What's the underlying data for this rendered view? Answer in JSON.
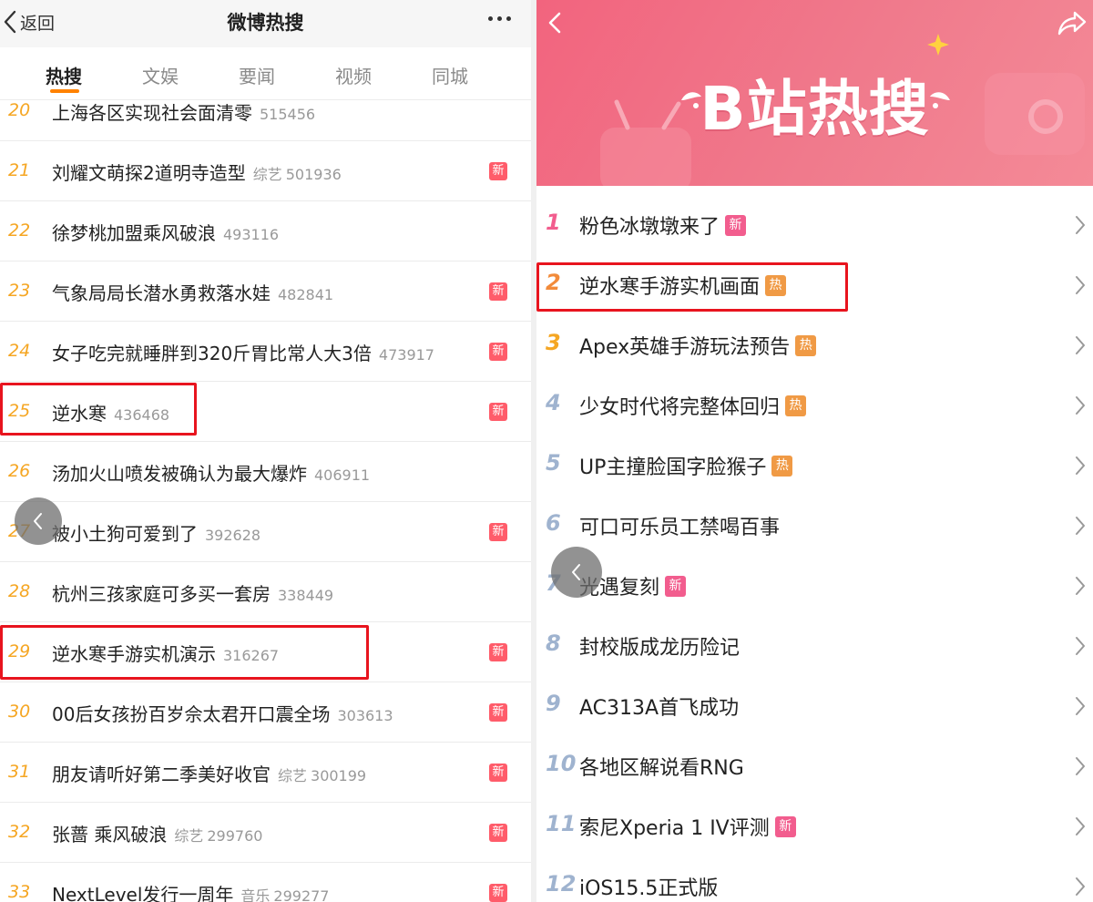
{
  "weibo": {
    "back_label": "返回",
    "title": "微博热搜",
    "tabs": [
      {
        "label": "热搜",
        "active": true
      },
      {
        "label": "文娱",
        "active": false
      },
      {
        "label": "要闻",
        "active": false
      },
      {
        "label": "视频",
        "active": false
      },
      {
        "label": "同城",
        "active": false
      }
    ],
    "items": [
      {
        "rank": "20",
        "title": "上海各区实现社会面清零",
        "category": "",
        "count": "515456",
        "badge": ""
      },
      {
        "rank": "21",
        "title": "刘耀文萌探2道明寺造型",
        "category": "综艺",
        "count": "501936",
        "badge": "新"
      },
      {
        "rank": "22",
        "title": "徐梦桃加盟乘风破浪",
        "category": "",
        "count": "493116",
        "badge": ""
      },
      {
        "rank": "23",
        "title": "气象局局长潜水勇救落水娃",
        "category": "",
        "count": "482841",
        "badge": "新"
      },
      {
        "rank": "24",
        "title": "女子吃完就睡胖到320斤胃比常人大3倍",
        "category": "",
        "count": "473917",
        "badge": "新"
      },
      {
        "rank": "25",
        "title": "逆水寒",
        "category": "",
        "count": "436468",
        "badge": "新"
      },
      {
        "rank": "26",
        "title": "汤加火山喷发被确认为最大爆炸",
        "category": "",
        "count": "406911",
        "badge": ""
      },
      {
        "rank": "27",
        "title": "被小土狗可爱到了",
        "category": "",
        "count": "392628",
        "badge": "新"
      },
      {
        "rank": "28",
        "title": "杭州三孩家庭可多买一套房",
        "category": "",
        "count": "338449",
        "badge": ""
      },
      {
        "rank": "29",
        "title": "逆水寒手游实机演示",
        "category": "",
        "count": "316267",
        "badge": "新"
      },
      {
        "rank": "30",
        "title": "00后女孩扮百岁佘太君开口震全场",
        "category": "",
        "count": "303613",
        "badge": "新"
      },
      {
        "rank": "31",
        "title": "朋友请听好第二季美好收官",
        "category": "综艺",
        "count": "300199",
        "badge": "新"
      },
      {
        "rank": "32",
        "title": "张蔷 乘风破浪",
        "category": "综艺",
        "count": "299760",
        "badge": "新"
      },
      {
        "rank": "33",
        "title": "NextLevel发行一周年",
        "category": "音乐",
        "count": "299277",
        "badge": "新"
      }
    ],
    "highlighted_ranks": [
      "25",
      "29"
    ]
  },
  "bili": {
    "title": "B站热搜",
    "items": [
      {
        "rank": "1",
        "title": "粉色冰墩墩来了",
        "badge": "新",
        "badge_type": "new"
      },
      {
        "rank": "2",
        "title": "逆水寒手游实机画面",
        "badge": "热",
        "badge_type": "hot"
      },
      {
        "rank": "3",
        "title": "Apex英雄手游玩法预告",
        "badge": "热",
        "badge_type": "hot"
      },
      {
        "rank": "4",
        "title": "少女时代将完整体回归",
        "badge": "热",
        "badge_type": "hot"
      },
      {
        "rank": "5",
        "title": "UP主撞脸国字脸猴子",
        "badge": "热",
        "badge_type": "hot"
      },
      {
        "rank": "6",
        "title": "可口可乐员工禁喝百事",
        "badge": "",
        "badge_type": ""
      },
      {
        "rank": "7",
        "title": "光遇复刻",
        "badge": "新",
        "badge_type": "new"
      },
      {
        "rank": "8",
        "title": "封校版成龙历险记",
        "badge": "",
        "badge_type": ""
      },
      {
        "rank": "9",
        "title": "AC313A首飞成功",
        "badge": "",
        "badge_type": ""
      },
      {
        "rank": "10",
        "title": "各地区解说看RNG",
        "badge": "",
        "badge_type": ""
      },
      {
        "rank": "11",
        "title": "索尼Xperia 1 IV评测",
        "badge": "新",
        "badge_type": "new"
      },
      {
        "rank": "12",
        "title": "iOS15.5正式版",
        "badge": "",
        "badge_type": ""
      }
    ],
    "highlighted_ranks": [
      "2"
    ]
  },
  "colors": {
    "weibo_accent": "#ff8200",
    "weibo_rank": "#f5a623",
    "new_badge": "#ff5c6a",
    "bili_pink": "#f25d8e",
    "bili_hot": "#f09a45",
    "highlight_box": "#e8141e"
  }
}
